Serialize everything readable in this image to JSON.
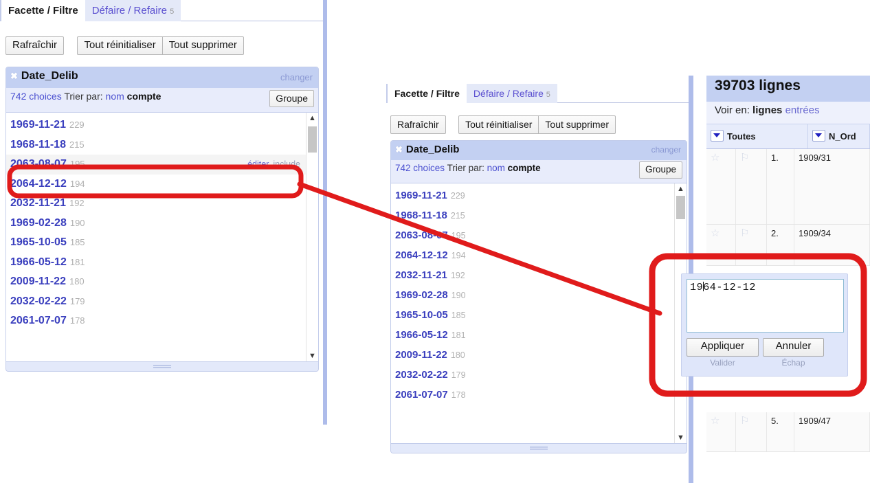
{
  "app": {
    "tabs": [
      {
        "label": "Facette / Filtre",
        "count": "",
        "active": true
      },
      {
        "label": "Défaire / Refaire",
        "count": "5",
        "active": false
      }
    ],
    "toolbar": {
      "refresh_label": "Rafraîchir",
      "reset_all_label": "Tout réinitialiser",
      "remove_all_label": "Tout supprimer"
    },
    "facet": {
      "close_icon": "close-icon",
      "title": "Date_Delib",
      "change_label": "changer",
      "choices_count": "742 choices",
      "sort_by_label": "Trier par:",
      "sort_name_label": "nom",
      "sort_count_label": "compte",
      "group_label": "Groupe",
      "edit_label": "éditer",
      "include_label": "include",
      "scroll_up_icon": "chevron-up-icon",
      "scroll_down_icon": "chevron-down-icon",
      "resize_grip_icon": "resize-grip-icon",
      "choices": [
        {
          "value": "1969-11-21",
          "count": "229"
        },
        {
          "value": "1968-11-18",
          "count": "215"
        },
        {
          "value": "2063-08-07",
          "count": "195"
        },
        {
          "value": "2064-12-12",
          "count": "194"
        },
        {
          "value": "2032-11-21",
          "count": "192"
        },
        {
          "value": "1969-02-28",
          "count": "190"
        },
        {
          "value": "1965-10-05",
          "count": "185"
        },
        {
          "value": "1966-05-12",
          "count": "181"
        },
        {
          "value": "2009-11-22",
          "count": "180"
        },
        {
          "value": "2032-02-22",
          "count": "179"
        },
        {
          "value": "2061-07-07",
          "count": "178"
        }
      ],
      "hovered_index": 2
    },
    "grid": {
      "rows_count_label": "39703 lignes",
      "view_as_label": "Voir en:",
      "view_rows_label": "lignes",
      "view_records_label": "entrées",
      "columns": [
        {
          "label": "Toutes",
          "dropdown_icon": "chevron-down-icon"
        },
        {
          "label": "N_Ord",
          "dropdown_icon": "chevron-down-icon"
        }
      ],
      "rows": [
        {
          "index": "1.",
          "n_ord": "1909/31",
          "star_icon": "star-icon",
          "flag_icon": "flag-icon"
        },
        {
          "index": "2.",
          "n_ord": "1909/34",
          "star_icon": "star-icon",
          "flag_icon": "flag-icon"
        },
        {
          "index": "5.",
          "n_ord": "1909/47",
          "star_icon": "star-icon",
          "flag_icon": "flag-icon"
        }
      ]
    },
    "edit_popup": {
      "value_before_caret": "19",
      "value_after_caret": "64-12-12",
      "full_value": "1964-12-12",
      "apply_label": "Appliquer",
      "cancel_label": "Annuler",
      "apply_hint": "Valider",
      "cancel_hint": "Échap"
    },
    "annotation": {
      "color": "#e01b1b",
      "highlight_row_name": "2063-08-07",
      "callout_target": "edit-popup"
    }
  }
}
